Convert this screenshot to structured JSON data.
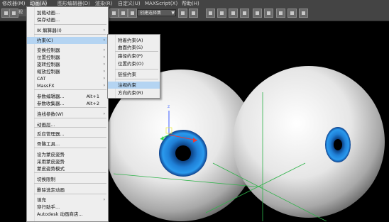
{
  "menubar": [
    {
      "label": "修改器(M)",
      "active": false
    },
    {
      "label": "动画(A)",
      "active": true
    },
    {
      "label": "图形编辑器(D)",
      "active": false
    },
    {
      "label": "渲染(R)",
      "active": false
    },
    {
      "label": "自定义(U)",
      "active": false
    },
    {
      "label": "MAXScript(X)",
      "active": false
    },
    {
      "label": "帮助(H)",
      "active": false
    }
  ],
  "toolbar": {
    "left_text": "视",
    "selection_set_placeholder": "创建选择集"
  },
  "animation_menu": [
    {
      "label": "加载动画..."
    },
    {
      "label": "保存动画..."
    },
    {
      "label": "IK 解算器(I)",
      "submenu": true
    },
    {
      "label": "约束(C)",
      "submenu": true,
      "highlight": true
    },
    {
      "label": "变换控制器",
      "submenu": true
    },
    {
      "label": "位置控制器",
      "submenu": true
    },
    {
      "label": "旋转控制器",
      "submenu": true
    },
    {
      "label": "缩放控制器",
      "submenu": true
    },
    {
      "label": "CAT",
      "submenu": true
    },
    {
      "label": "MassFX",
      "submenu": true
    },
    {
      "label": "参数编辑器...",
      "shortcut": "Alt+1"
    },
    {
      "label": "参数收集器...",
      "shortcut": "Alt+2"
    },
    {
      "label": "连线参数(W)",
      "submenu": true
    },
    {
      "label": "动画层..."
    },
    {
      "label": "反应管理器..."
    },
    {
      "label": "骨骼工具..."
    },
    {
      "label": "设为蒙皮姿势"
    },
    {
      "label": "采用蒙皮姿势"
    },
    {
      "label": "蒙皮姿势模式"
    },
    {
      "label": "切换限制"
    },
    {
      "label": "删除选定动画"
    },
    {
      "label": "填充",
      "submenu": true
    },
    {
      "label": "穿行助手..."
    },
    {
      "label": "Autodesk 动画商店..."
    }
  ],
  "constraints_menu": [
    {
      "label": "附着约束(A)"
    },
    {
      "label": "曲面约束(S)"
    },
    {
      "label": "路径约束(P)"
    },
    {
      "label": "位置约束(O)"
    },
    {
      "label": "链接约束"
    },
    {
      "label": "注视约束",
      "highlight": true
    },
    {
      "label": "方向约束(R)"
    }
  ],
  "viewport": {
    "gizmo_axis_label": "z"
  }
}
